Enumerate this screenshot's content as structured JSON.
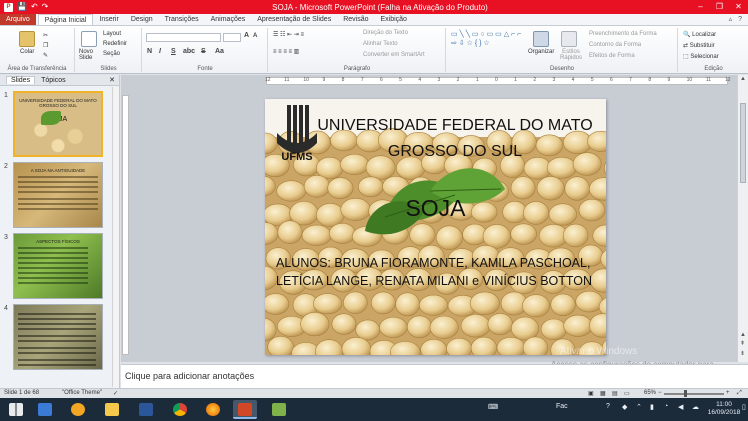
{
  "titlebar": {
    "title": "SOJA - Microsoft PowerPoint (Falha na Ativação do Produto)",
    "minimize": "–",
    "restore": "❐",
    "close": "✕",
    "quick_save": "💾",
    "quick_undo": "↶",
    "quick_redo": "↷"
  },
  "ribbon_tabs": [
    "Arquivo",
    "Página Inicial",
    "Inserir",
    "Design",
    "Transições",
    "Animações",
    "Apresentação de Slides",
    "Revisão",
    "Exibição"
  ],
  "ribbon_right": {
    "collapse": "▵",
    "help": "?"
  },
  "ribbon": {
    "clipboard": {
      "paste": "Colar",
      "label": "Área de Transferência"
    },
    "slides": {
      "new_slide": "Novo Slide",
      "layout": "Layout",
      "reset": "Redefinir",
      "section": "Seção",
      "label": "Slides"
    },
    "font": {
      "label": "Fonte",
      "bold": "N",
      "italic": "I",
      "underline": "S",
      "strike": "S",
      "shadow": "abc",
      "grow": "A",
      "shrink": "A",
      "clear": "Aa"
    },
    "paragraph": {
      "label": "Parágrafo",
      "direction": "Direção do Texto",
      "align": "Alinhar Texto",
      "smartart": "Converter em SmartArt"
    },
    "drawing": {
      "arrange": "Organizar",
      "styles": "Estilos Rápidos",
      "fill": "Preenchimento da Forma",
      "outline": "Contorno da Forma",
      "effects": "Efeitos de Forma",
      "label": "Desenho"
    },
    "editing": {
      "find": "Localizar",
      "replace": "Substituir",
      "select": "Selecionar",
      "label": "Edição"
    }
  },
  "left_panel": {
    "tab_slides": "Slides",
    "tab_outline": "Tópicos",
    "close": "✕",
    "thumbnails": [
      {
        "num": "1",
        "title": "UNIVERSIDADE FEDERAL DO MATO GROSSO DO SUL",
        "sub": "SOJA"
      },
      {
        "num": "2",
        "title": "A SOJA NA ANTIGUIDADE",
        "sub": ""
      },
      {
        "num": "3",
        "title": "ASPECTOS FÍSICOS",
        "sub": ""
      },
      {
        "num": "4",
        "title": "",
        "sub": ""
      }
    ]
  },
  "slide": {
    "title_line1": "UNIVERSIDADE FEDERAL DO MATO",
    "title_line2": "GROSSO DO SUL",
    "subtitle": "SOJA",
    "body_line1": "ALUNOS: BRUNA FIORAMONTE, KAMILA PASCHOAL,",
    "body_line2": "LETÍCIA LANGE, RENATA MILANI e VINÍCIUS BOTTON",
    "logo_text": "UFMS"
  },
  "ruler": [
    "12",
    "11",
    "10",
    "9",
    "8",
    "7",
    "6",
    "5",
    "4",
    "3",
    "2",
    "1",
    "0",
    "1",
    "2",
    "3",
    "4",
    "5",
    "6",
    "7",
    "8",
    "9",
    "10",
    "11",
    "12"
  ],
  "notes_placeholder": "Clique para adicionar anotações",
  "watermark": {
    "line1": "Ativar o Windows",
    "line2": "Acesse as configurações do computador para ativar o Windows."
  },
  "statusbar": {
    "slide_info": "Slide 1 de 68",
    "theme": "\"Office Theme\"",
    "zoom": "65%",
    "zoom_minus": "−",
    "zoom_plus": "+"
  },
  "taskbar": {
    "tray_lang": "Fac",
    "time": "11:00",
    "date": "16/09/2018"
  }
}
